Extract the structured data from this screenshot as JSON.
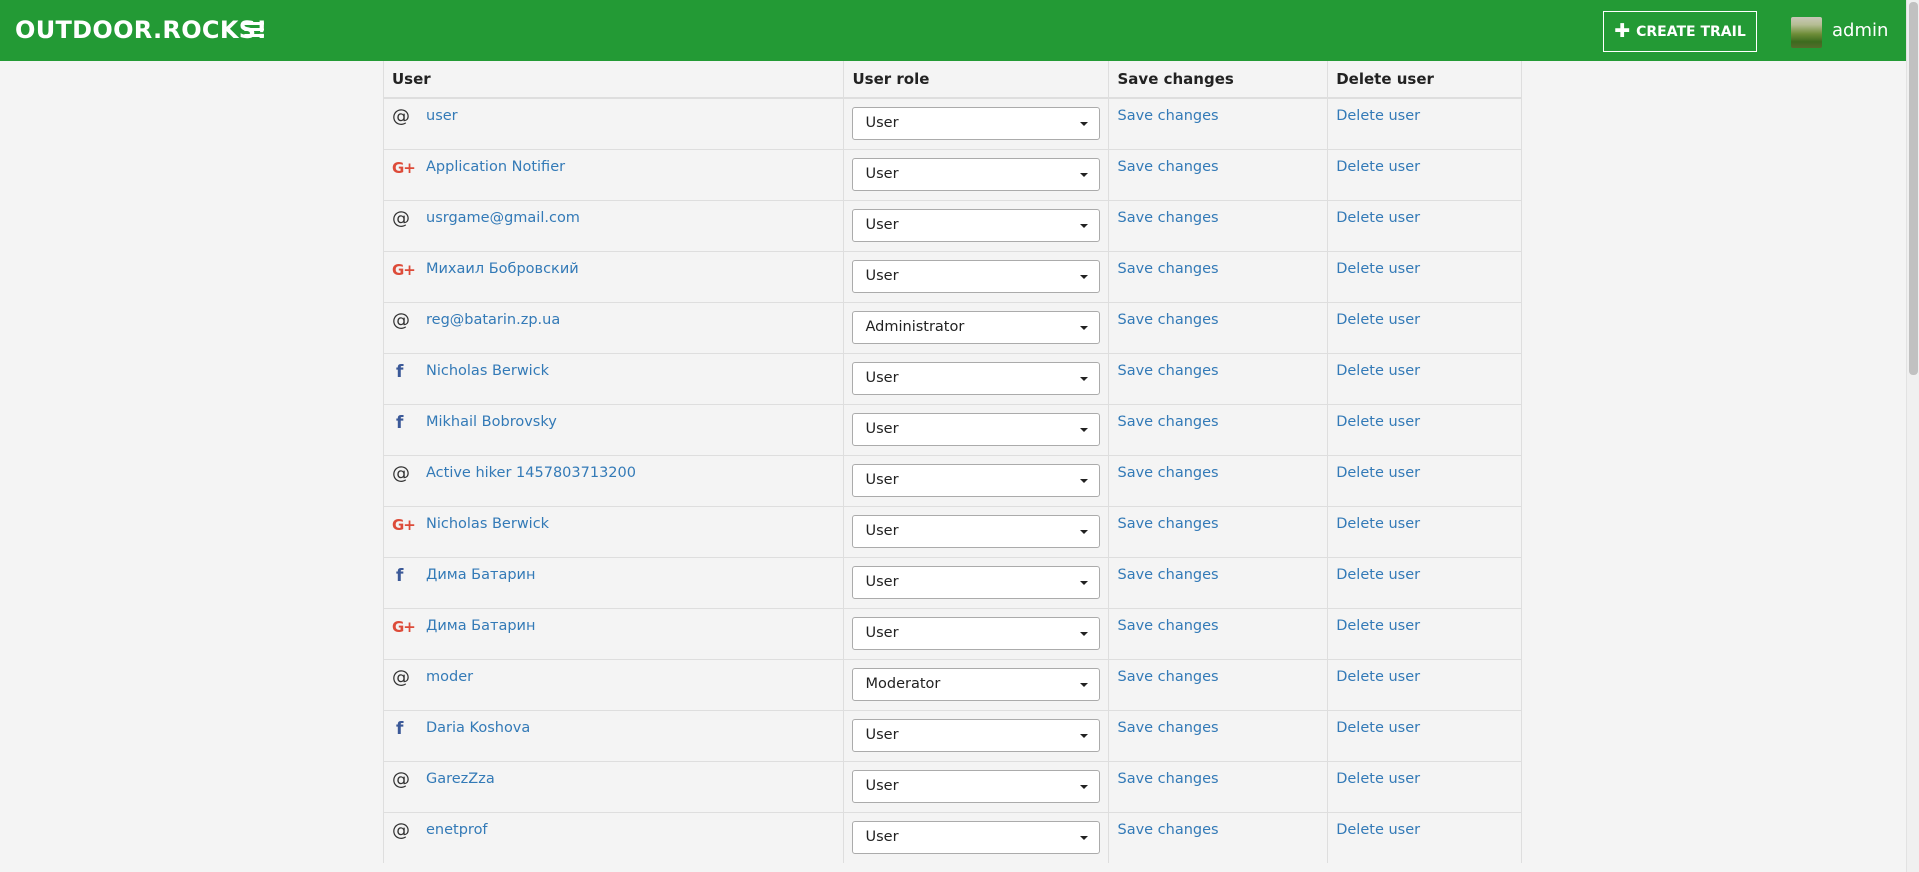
{
  "brand": "OUTDOOR.ROCKS!",
  "create_trail": "CREATE TRAIL",
  "current_user": "admin",
  "table": {
    "headers": [
      "User",
      "User role",
      "Save changes",
      "Delete user"
    ],
    "save_label": "Save changes",
    "delete_label": "Delete user",
    "rows": [
      {
        "provider": "email",
        "name": "user",
        "role": "User"
      },
      {
        "provider": "google",
        "name": "Application Notifier",
        "role": "User"
      },
      {
        "provider": "email",
        "name": "usrgame@gmail.com",
        "role": "User"
      },
      {
        "provider": "google",
        "name": "Михаил Бобровский",
        "role": "User"
      },
      {
        "provider": "email",
        "name": "reg@batarin.zp.ua",
        "role": "Administrator"
      },
      {
        "provider": "facebook",
        "name": "Nicholas Berwick",
        "role": "User"
      },
      {
        "provider": "facebook",
        "name": "Mikhail Bobrovsky",
        "role": "User"
      },
      {
        "provider": "email",
        "name": "Active hiker 1457803713200",
        "role": "User"
      },
      {
        "provider": "google",
        "name": "Nicholas Berwick",
        "role": "User"
      },
      {
        "provider": "facebook",
        "name": "Дима Батарин",
        "role": "User"
      },
      {
        "provider": "google",
        "name": "Дима Батарин",
        "role": "User"
      },
      {
        "provider": "email",
        "name": "moder",
        "role": "Moderator"
      },
      {
        "provider": "facebook",
        "name": "Daria Koshova",
        "role": "User"
      },
      {
        "provider": "email",
        "name": "GarezZza",
        "role": "User"
      },
      {
        "provider": "email",
        "name": "enetprof",
        "role": "User"
      }
    ]
  },
  "icons": {
    "email": "at-icon",
    "google": "google-plus-icon",
    "facebook": "facebook-icon"
  },
  "colors": {
    "navbar": "#239a35",
    "link": "#337ab7",
    "google": "#dd4b39",
    "facebook": "#3b5998"
  }
}
